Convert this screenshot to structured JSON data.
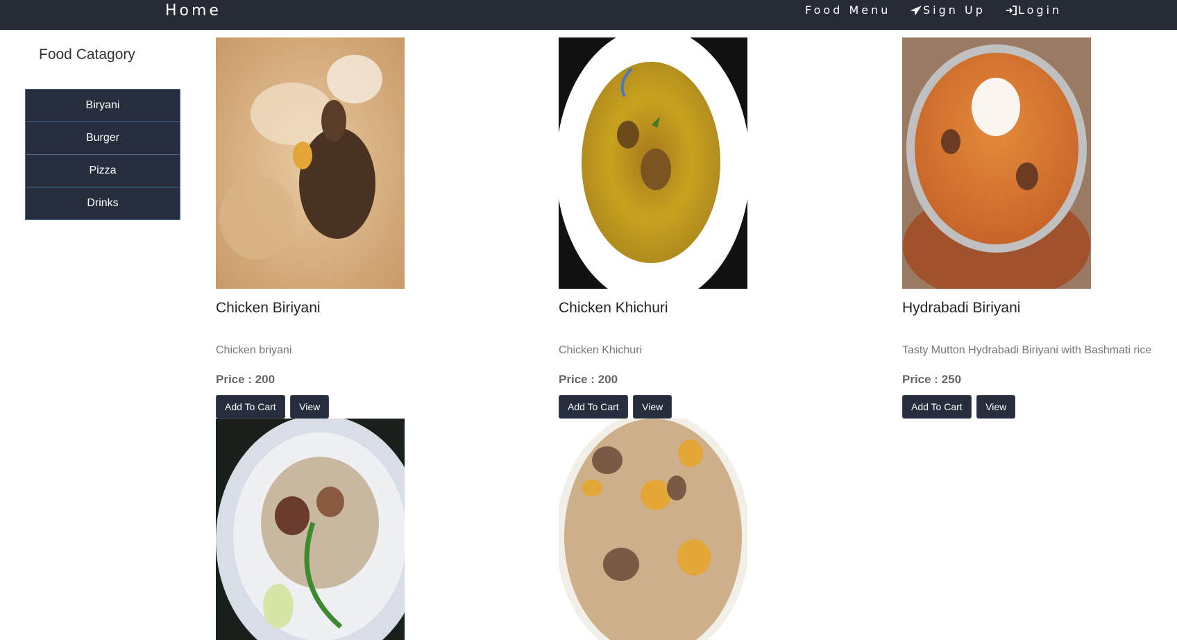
{
  "navbar": {
    "brand": "Home",
    "links": [
      {
        "label": "Food Menu",
        "icon": ""
      },
      {
        "label": "Sign Up",
        "icon": "paper-plane-icon"
      },
      {
        "label": "Login",
        "icon": "sign-in-icon"
      }
    ]
  },
  "sidebar": {
    "title": "Food Catagory",
    "items": [
      {
        "label": "Biryani"
      },
      {
        "label": "Burger"
      },
      {
        "label": "Pizza"
      },
      {
        "label": "Drinks"
      }
    ]
  },
  "products": [
    {
      "name": "Chicken Biriyani",
      "description": "Chicken briyani",
      "price": "Price : 200",
      "add_label": "Add To Cart",
      "view_label": "View"
    },
    {
      "name": "Chicken Khichuri",
      "description": "Chicken Khichuri",
      "price": "Price : 200",
      "add_label": "Add To Cart",
      "view_label": "View"
    },
    {
      "name": "Hydrabadi Biriyani",
      "description": "Tasty Mutton Hydrabadi Biriyani with Bashmati rice",
      "price": "Price : 250",
      "add_label": "Add To Cart",
      "view_label": "View"
    },
    {
      "name": "",
      "description": "",
      "price": "",
      "add_label": "",
      "view_label": ""
    },
    {
      "name": "",
      "description": "",
      "price": "",
      "add_label": "",
      "view_label": ""
    }
  ],
  "colors": {
    "navbar_bg": "#262b35",
    "button_bg": "#262d3c",
    "category_border": "#4a6d99"
  }
}
